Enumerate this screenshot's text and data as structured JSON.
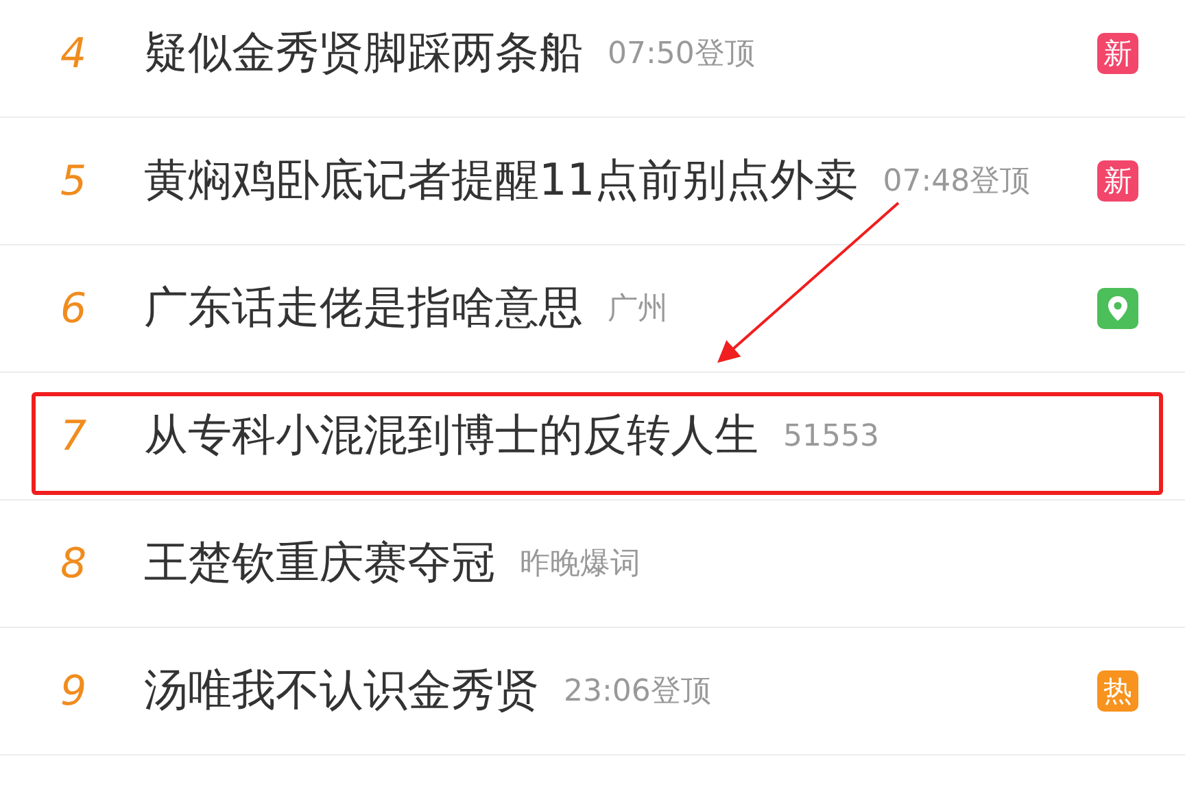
{
  "rows": [
    {
      "rank": "4",
      "title": "疑似金秀贤脚踩两条船",
      "meta": "07:50登顶",
      "highlighted": false,
      "badge": {
        "kind": "label",
        "text": "新",
        "color": "#f2466b"
      }
    },
    {
      "rank": "5",
      "title": "黄焖鸡卧底记者提醒11点前别点外卖",
      "meta": "07:48登顶",
      "highlighted": false,
      "badge": {
        "kind": "label",
        "text": "新",
        "color": "#f2466b"
      }
    },
    {
      "rank": "6",
      "title": "广东话走佬是指啥意思",
      "meta": "广州",
      "highlighted": false,
      "badge": {
        "kind": "location",
        "color": "#4cbe5a"
      }
    },
    {
      "rank": "7",
      "title": "从专科小混混到博士的反转人生",
      "meta": "51553",
      "highlighted": true
    },
    {
      "rank": "8",
      "title": "王楚钦重庆赛夺冠",
      "meta": "昨晚爆词",
      "highlighted": false
    },
    {
      "rank": "9",
      "title": "汤唯我不认识金秀贤",
      "meta": "23:06登顶",
      "highlighted": false,
      "badge": {
        "kind": "label",
        "text": "热",
        "color": "#f7931e"
      }
    }
  ],
  "arrow_annotation": true
}
